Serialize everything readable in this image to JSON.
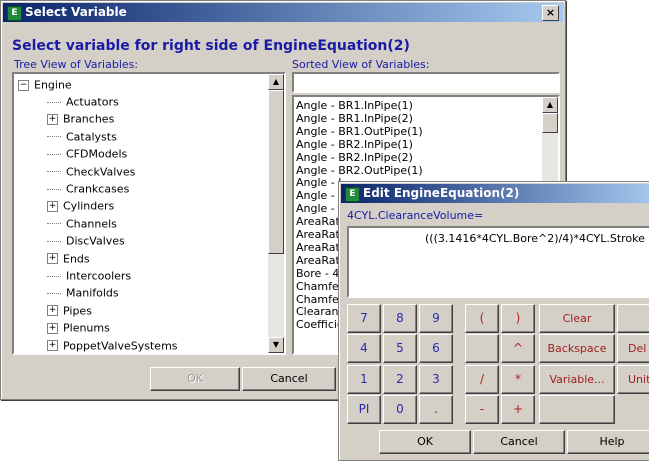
{
  "select_window": {
    "title": "Select Variable",
    "close_glyph": "×",
    "heading": "Select variable for right side of EngineEquation(2)",
    "tree_label": "Tree View of Variables:",
    "sorted_label": "Sorted View of Variables:",
    "search_value": "",
    "tree": {
      "root": "Engine",
      "root_expander": "−",
      "items": [
        {
          "label": "Actuators",
          "expander": ""
        },
        {
          "label": "Branches",
          "expander": "+"
        },
        {
          "label": "Catalysts",
          "expander": ""
        },
        {
          "label": "CFDModels",
          "expander": ""
        },
        {
          "label": "CheckValves",
          "expander": ""
        },
        {
          "label": "Crankcases",
          "expander": ""
        },
        {
          "label": "Cylinders",
          "expander": "+"
        },
        {
          "label": "Channels",
          "expander": ""
        },
        {
          "label": "DiscValves",
          "expander": ""
        },
        {
          "label": "Ends",
          "expander": "+"
        },
        {
          "label": "Intercoolers",
          "expander": ""
        },
        {
          "label": "Manifolds",
          "expander": ""
        },
        {
          "label": "Pipes",
          "expander": "+"
        },
        {
          "label": "Plenums",
          "expander": "+"
        },
        {
          "label": "PoppetValveSystems",
          "expander": "+"
        }
      ]
    },
    "sorted_items": [
      "Angle - BR1.InPipe(1)",
      "Angle - BR1.InPipe(2)",
      "Angle - BR1.OutPipe(1)",
      "Angle - BR2.InPipe(1)",
      "Angle - BR2.InPipe(2)",
      "Angle - BR2.OutPipe(1)",
      "Angle - I",
      "Angle - I",
      "Angle - I",
      "AreaRat",
      "AreaRat",
      "AreaRat",
      "AreaRat",
      "Bore - 4",
      "Chamfer",
      "Chamfer",
      "Clearanc",
      "Coefficie"
    ],
    "ok_label": "OK",
    "cancel_label": "Cancel"
  },
  "edit_window": {
    "title": "Edit EngineEquation(2)",
    "variable_label": "4CYL.ClearanceVolume=",
    "equation": "(((3.1416*4CYL.Bore^2)/4)*4CYL.Stroke",
    "keypad": [
      [
        "7",
        "8",
        "9",
        "(",
        ")"
      ],
      [
        "4",
        "5",
        "6",
        "",
        "^"
      ],
      [
        "1",
        "2",
        "3",
        "/",
        "*"
      ],
      [
        "PI",
        "0",
        ".",
        "-",
        "+"
      ]
    ],
    "side_buttons": [
      "Clear",
      "Backspace",
      "Variable..."
    ],
    "right_buttons": [
      "",
      "Del",
      "Unit"
    ],
    "ok_label": "OK",
    "cancel_label": "Cancel",
    "help_label": "Help"
  },
  "colors": {
    "title_start": "#0a246a",
    "title_end": "#a6caf0",
    "label_blue": "#1a1aa6",
    "face": "#d4d0c8"
  }
}
